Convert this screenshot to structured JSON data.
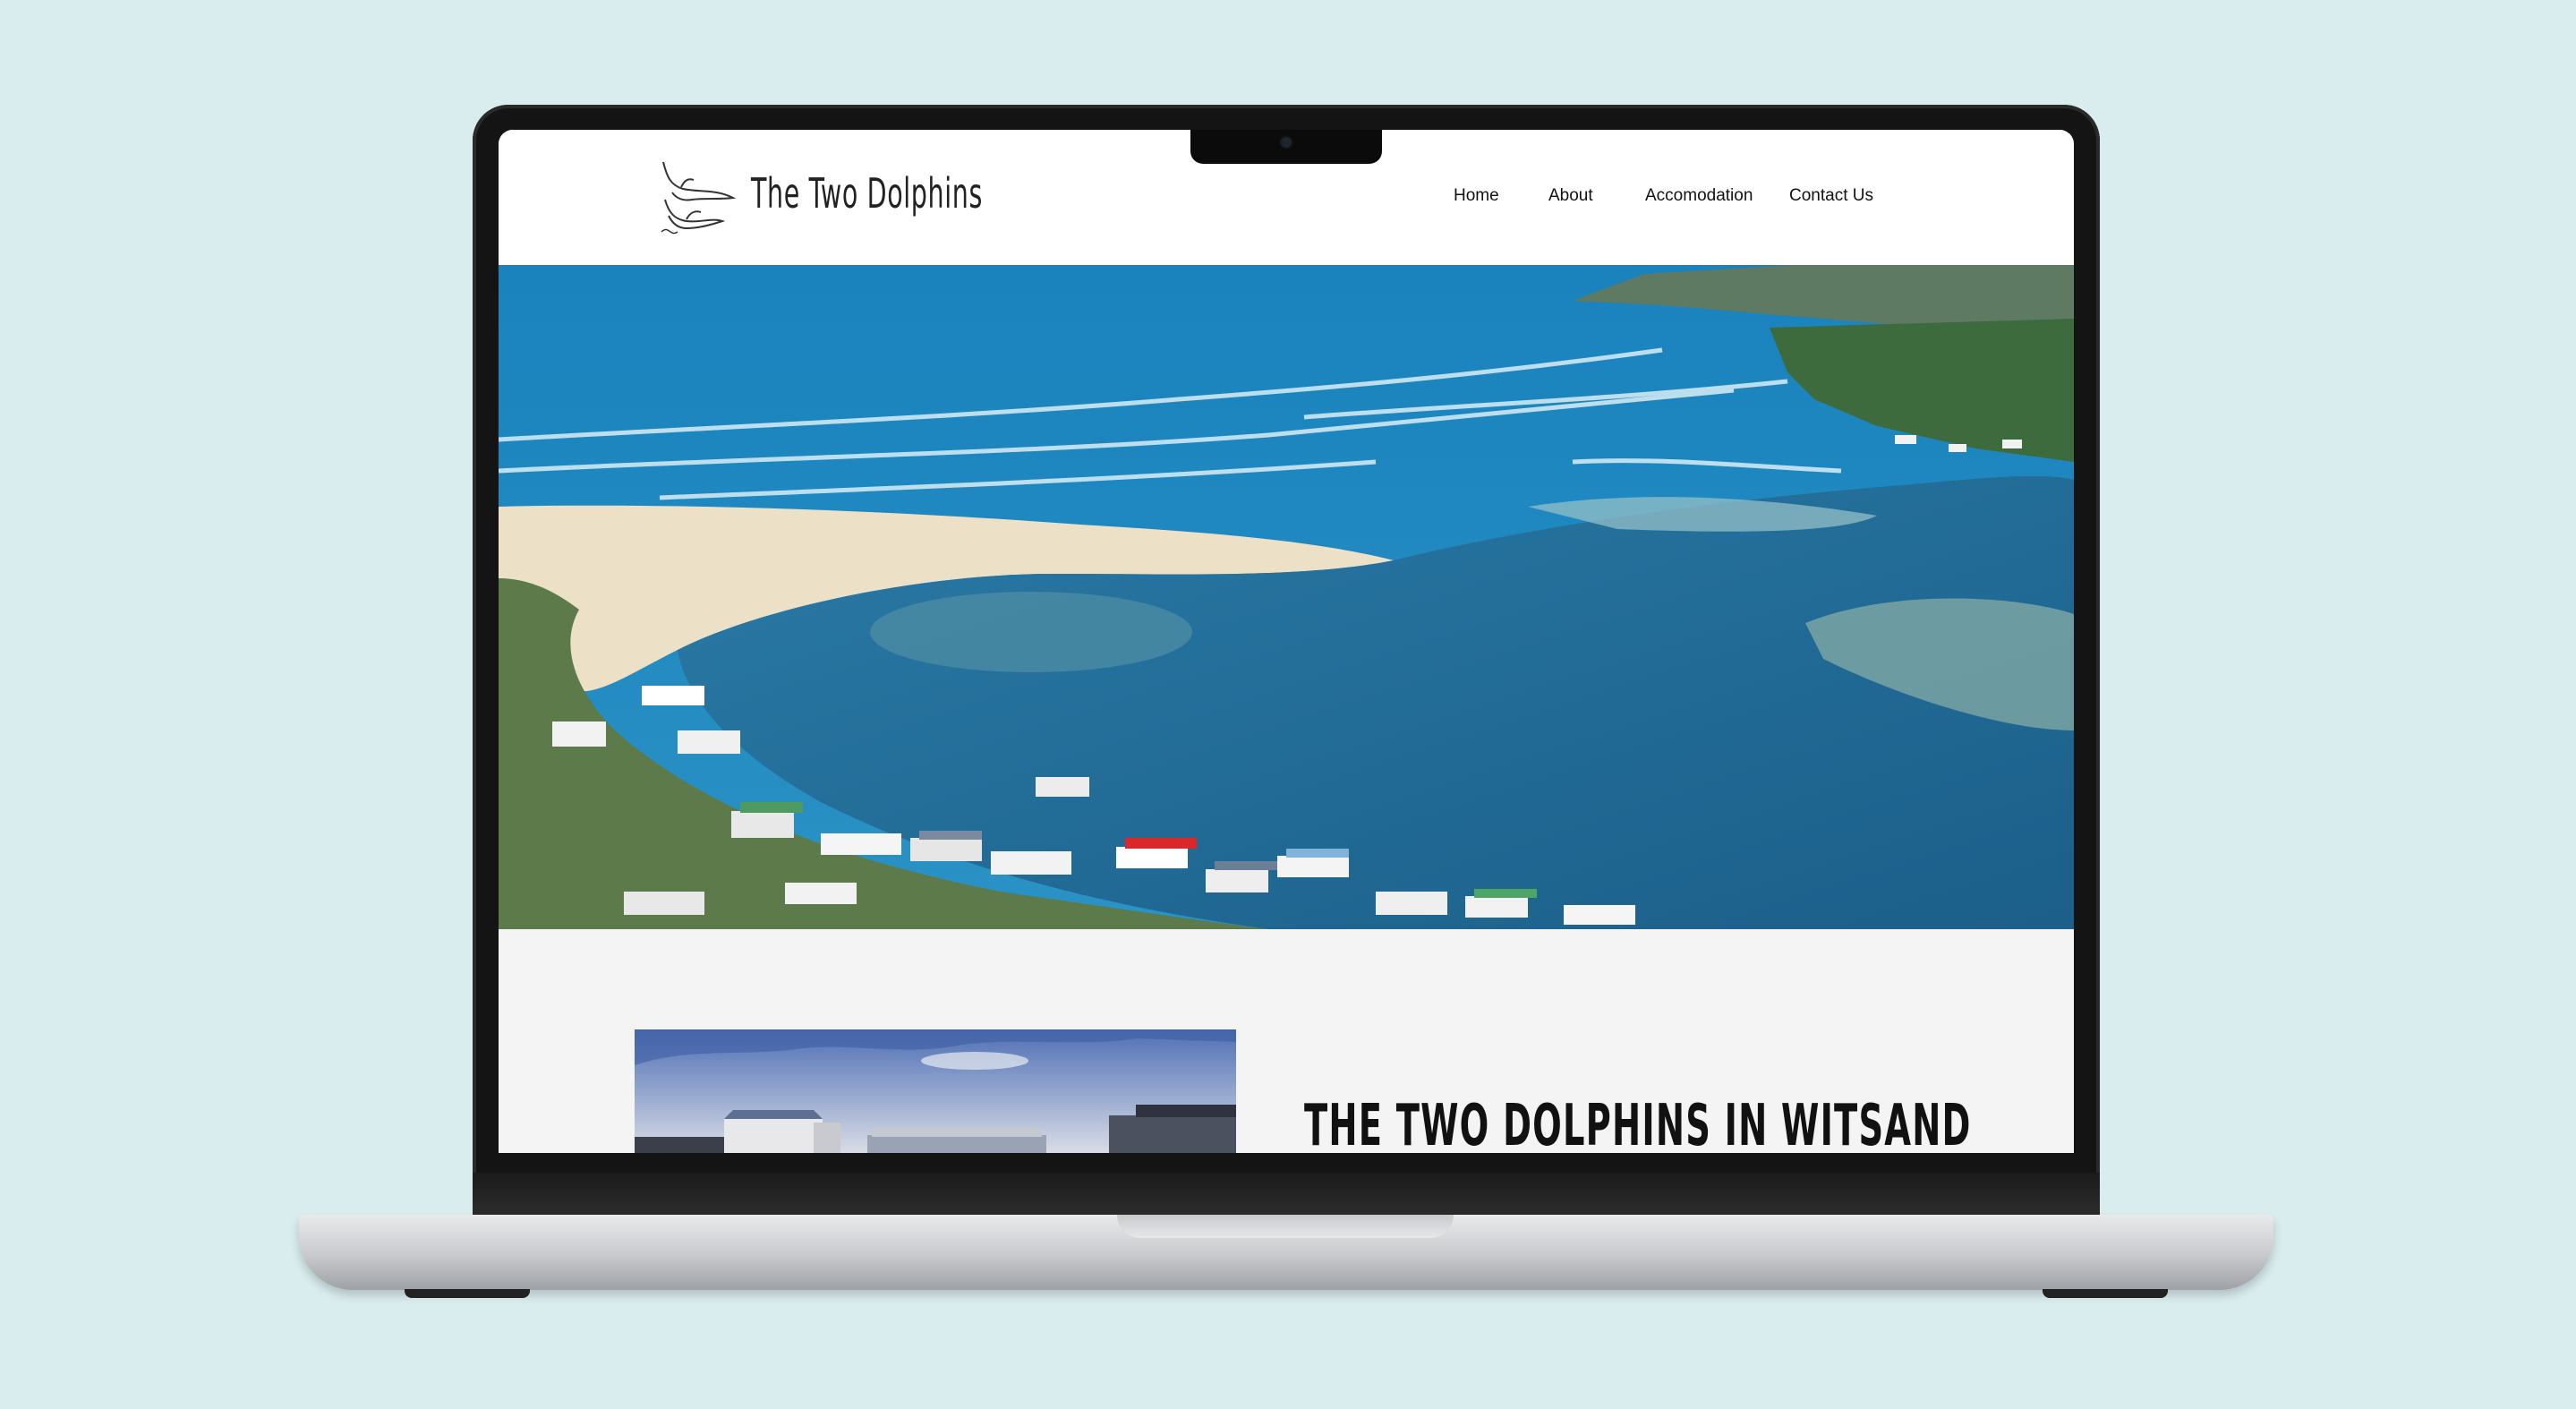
{
  "site": {
    "brand": "The Two Dolphins",
    "nav": [
      {
        "label": "Home"
      },
      {
        "label": "About"
      },
      {
        "label": "Accomodation"
      },
      {
        "label": "Contact Us"
      }
    ],
    "hero_image": "aerial-estuary-beach-photo",
    "section_heading": "THE TWO DOLPHINS IN WITSAND",
    "section_image": "houses-photo"
  },
  "colors": {
    "background": "#d9ecee",
    "screen_bg": "#ffffff",
    "content_bg": "#f4f4f4",
    "sea": "#1e86be",
    "lagoon": "#1e6b95",
    "sand": "#ece1c7"
  }
}
